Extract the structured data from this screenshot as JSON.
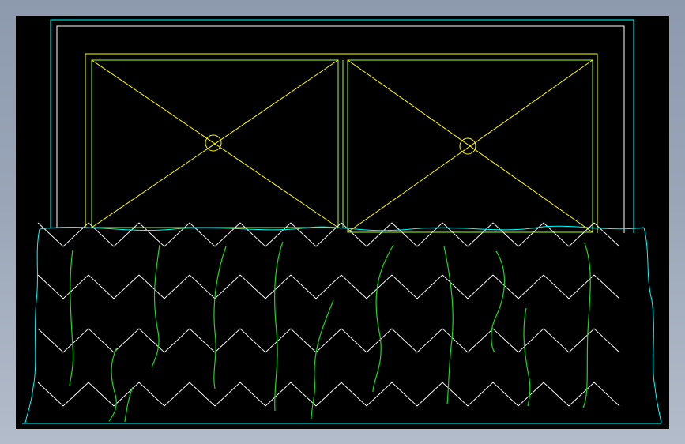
{
  "canvas": {
    "background": "#000000",
    "frame_color": "#9aa6b8"
  },
  "colors": {
    "cyan": "#00ffff",
    "yellow": "#ffff00",
    "green": "#00ff00",
    "light_green": "#bfff4a",
    "white": "#ffffff",
    "grass": "#1ed81e"
  },
  "drawing": {
    "subject": "bed elevation",
    "parts": [
      "headboard-outer-frame",
      "headboard-inner-frame",
      "upholstered-panels",
      "button-tufts",
      "quilted-bedspread"
    ]
  }
}
